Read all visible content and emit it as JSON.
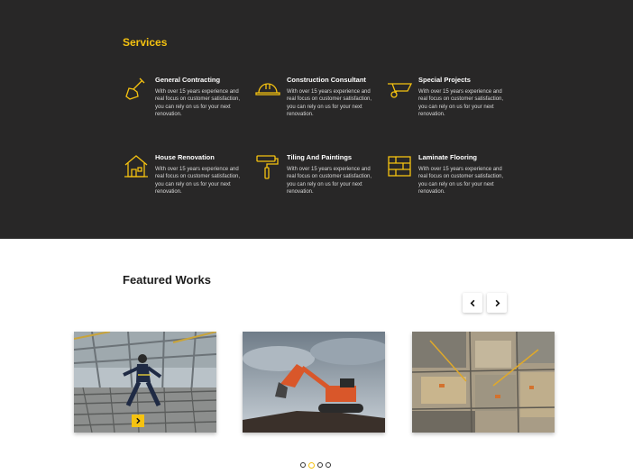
{
  "services": {
    "title": "Services",
    "items": [
      {
        "title": "General Contracting",
        "desc": "With over 15 years experience and real focus on customer satisfaction, you can rely on us for your next renovation.",
        "icon": "shovel-icon"
      },
      {
        "title": "Construction Consultant",
        "desc": "With over 15 years experience and real focus on customer satisfaction, you can rely on us for your next renovation.",
        "icon": "hard-hat-icon"
      },
      {
        "title": "Special Projects",
        "desc": "With over 15 years experience and real focus on customer satisfaction, you can rely on us for your next renovation.",
        "icon": "wheelbarrow-icon"
      },
      {
        "title": "House Renovation",
        "desc": "With over 15 years experience and real focus on customer satisfaction, you can rely on us for your next renovation.",
        "icon": "house-icon"
      },
      {
        "title": "Tiling And Paintings",
        "desc": "With over 15 years experience and real focus on customer satisfaction, you can rely on us for your next renovation.",
        "icon": "paint-roller-icon"
      },
      {
        "title": "Laminate Flooring",
        "desc": "With over 15 years experience and real focus on customer satisfaction, you can rely on us for your next renovation.",
        "icon": "brick-wall-icon"
      }
    ]
  },
  "featured": {
    "title": "Featured Works",
    "prev_icon": "chevron-left-icon",
    "next_icon": "chevron-right-icon",
    "works": [
      {
        "image": "worker-on-rebar-photo"
      },
      {
        "image": "excavator-photo"
      },
      {
        "image": "construction-site-aerial-photo"
      }
    ],
    "active_dot": 2,
    "dot_count": 4
  },
  "colors": {
    "accent": "#f5c210",
    "dark_bg": "#282727",
    "text_dark": "#1c1c1c"
  }
}
